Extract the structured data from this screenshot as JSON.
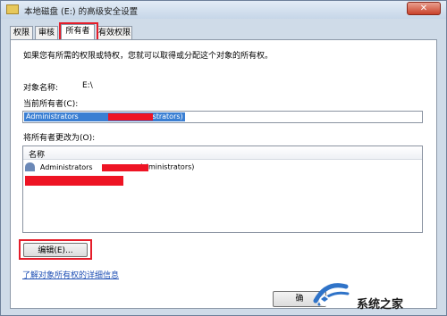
{
  "window": {
    "title": "本地磁盘 (E:) 的高级安全设置",
    "close_label": "✕"
  },
  "tabs": [
    {
      "label": "权限"
    },
    {
      "label": "审核"
    },
    {
      "label": "所有者"
    },
    {
      "label": "有效权限"
    }
  ],
  "content": {
    "intro": "如果您有所需的权限或特权，您就可以取得或分配这个对象的所有权。",
    "object_name_label": "对象名称:",
    "object_name_value": "E:\\",
    "current_owner_label": "当前所有者(C):",
    "current_owner_value_prefix": "Administrators",
    "current_owner_value_suffix": "(Administrators)",
    "change_owner_label": "将所有者更改为(O):",
    "list": {
      "column_name": "名称",
      "rows": [
        {
          "prefix": "Administrators",
          "suffix": "Administrators)"
        }
      ]
    },
    "edit_button": "编辑(E)...",
    "learn_link": "了解对象所有权的详细信息"
  },
  "footer": {
    "ok_button": "确"
  },
  "watermark": {
    "text": "系统之家"
  },
  "colors": {
    "highlight_red": "#e51d2a",
    "selection_blue": "#3a7fd3",
    "link_blue": "#1e4fb4"
  }
}
